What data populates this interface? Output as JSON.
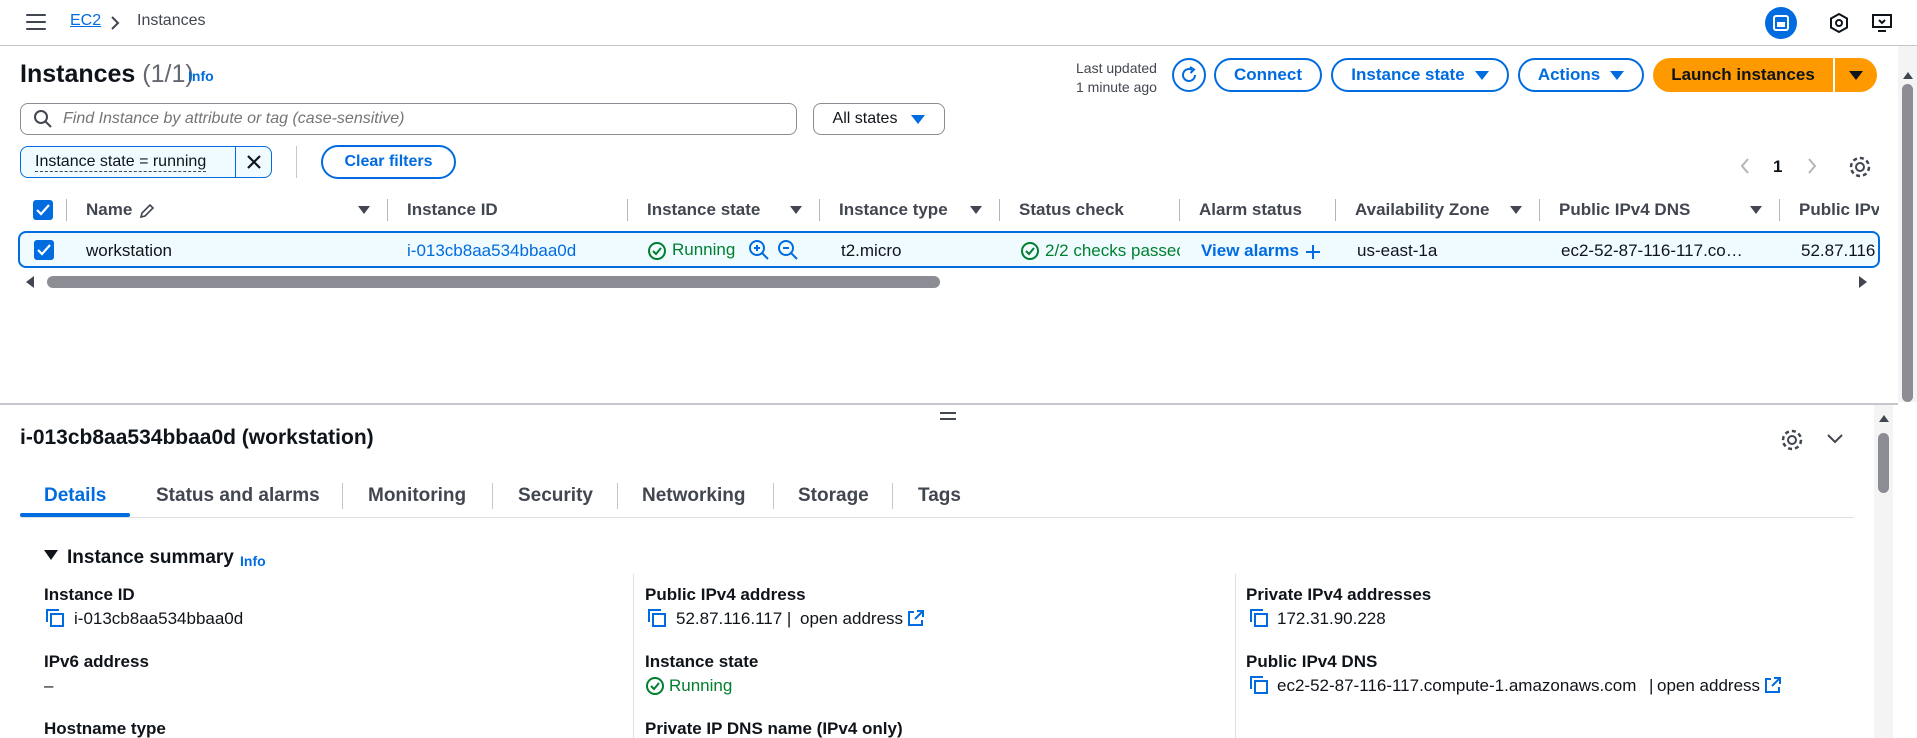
{
  "breadcrumb": {
    "service": "EC2",
    "page": "Instances"
  },
  "header": {
    "title": "Instances",
    "count": "(1/1)",
    "info": "Info",
    "last_updated_label": "Last updated",
    "last_updated_value": "1 minute ago",
    "connect": "Connect",
    "instance_state": "Instance state",
    "actions": "Actions",
    "launch": "Launch instances"
  },
  "search": {
    "placeholder": "Find Instance by attribute or tag (case-sensitive)",
    "state_filter": "All states"
  },
  "filters": {
    "token": "Instance state = running",
    "clear": "Clear filters"
  },
  "pagination": {
    "page": "1"
  },
  "table": {
    "columns": [
      "Name",
      "Instance ID",
      "Instance state",
      "Instance type",
      "Status check",
      "Alarm status",
      "Availability Zone",
      "Public IPv4 DNS",
      "Public IPv"
    ],
    "row": {
      "name": "workstation",
      "instance_id": "i-013cb8aa534bbaa0d",
      "state": "Running",
      "type": "t2.micro",
      "status_check": "2/2 checks passec",
      "alarm": "View alarms",
      "az": "us-east-1a",
      "dns": "ec2-52-87-116-117.co…",
      "ip": "52.87.116"
    }
  },
  "detail": {
    "title": "i-013cb8aa534bbaa0d (workstation)",
    "tabs": [
      "Details",
      "Status and alarms",
      "Monitoring",
      "Security",
      "Networking",
      "Storage",
      "Tags"
    ],
    "section": "Instance summary",
    "section_info": "Info",
    "fields": {
      "instance_id_label": "Instance ID",
      "instance_id": "i-013cb8aa534bbaa0d",
      "ipv6_label": "IPv6 address",
      "ipv6": "–",
      "hostname_label": "Hostname type",
      "public_ipv4_label": "Public IPv4 address",
      "public_ipv4": "52.87.116.117 |",
      "open_address": "open address",
      "state_label": "Instance state",
      "state": "Running",
      "private_dns_label": "Private IP DNS name (IPv4 only)",
      "private_ipv4_label": "Private IPv4 addresses",
      "private_ipv4": "172.31.90.228",
      "public_dns_label": "Public IPv4 DNS",
      "public_dns": "ec2-52-87-116-117.compute-1.amazonaws.com",
      "open_address2": "open address"
    }
  },
  "colors": {
    "accent": "#006ce0",
    "primary": "#ff9900",
    "success": "#00802f"
  }
}
